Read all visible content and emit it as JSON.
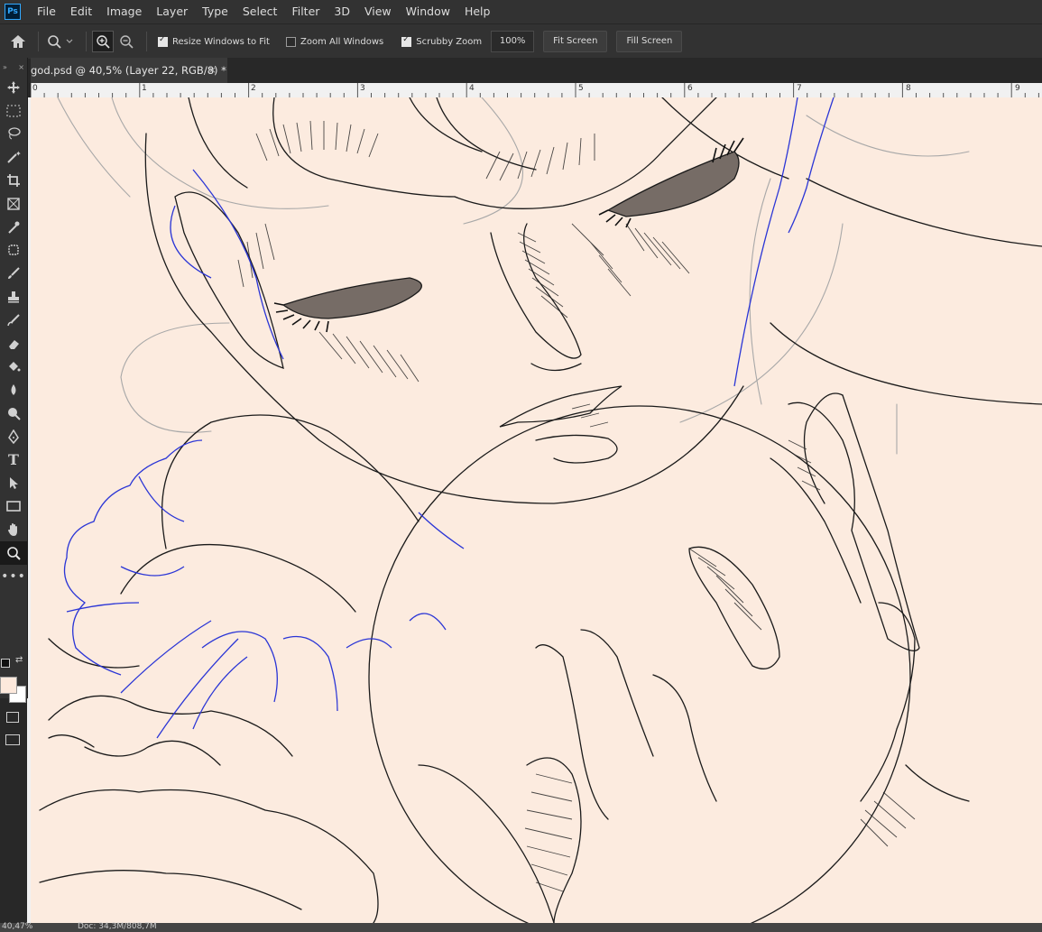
{
  "menu": {
    "app_icon": "Ps",
    "items": [
      "File",
      "Edit",
      "Image",
      "Layer",
      "Type",
      "Select",
      "Filter",
      "3D",
      "View",
      "Window",
      "Help"
    ]
  },
  "options": {
    "resize_windows": "Resize Windows to Fit",
    "zoom_all": "Zoom All Windows",
    "scrubby_zoom": "Scrubby Zoom",
    "zoom_value": "100%",
    "fit_screen": "Fit Screen",
    "fill_screen": "Fill Screen"
  },
  "document": {
    "tab_title": "god.psd @ 40,5% (Layer 22, RGB/8) *",
    "close": "×"
  },
  "ruler": {
    "labels": [
      "0",
      "1",
      "2",
      "3",
      "4",
      "5",
      "6",
      "7",
      "8",
      "9"
    ]
  },
  "status": {
    "zoom": "40,47%",
    "doc": "Doc: 34,3M/808,7M"
  },
  "colors": {
    "canvas": "#fcebdf",
    "foreground": "#fde9dc",
    "background": "#ffffff",
    "accent": "#31a8ff"
  },
  "toolbar": {
    "icons": [
      "move-icon",
      "marquee-icon",
      "lasso-icon",
      "magic-wand-icon",
      "crop-icon",
      "frame-icon",
      "eyedropper-icon",
      "healing-icon",
      "brush-icon",
      "stamp-icon",
      "history-brush-icon",
      "eraser-icon",
      "paint-bucket-icon",
      "blur-icon",
      "dodge-icon",
      "pen-icon",
      "type-icon",
      "path-select-icon",
      "rectangle-icon",
      "hand-icon",
      "zoom-icon",
      "more-icon"
    ]
  }
}
